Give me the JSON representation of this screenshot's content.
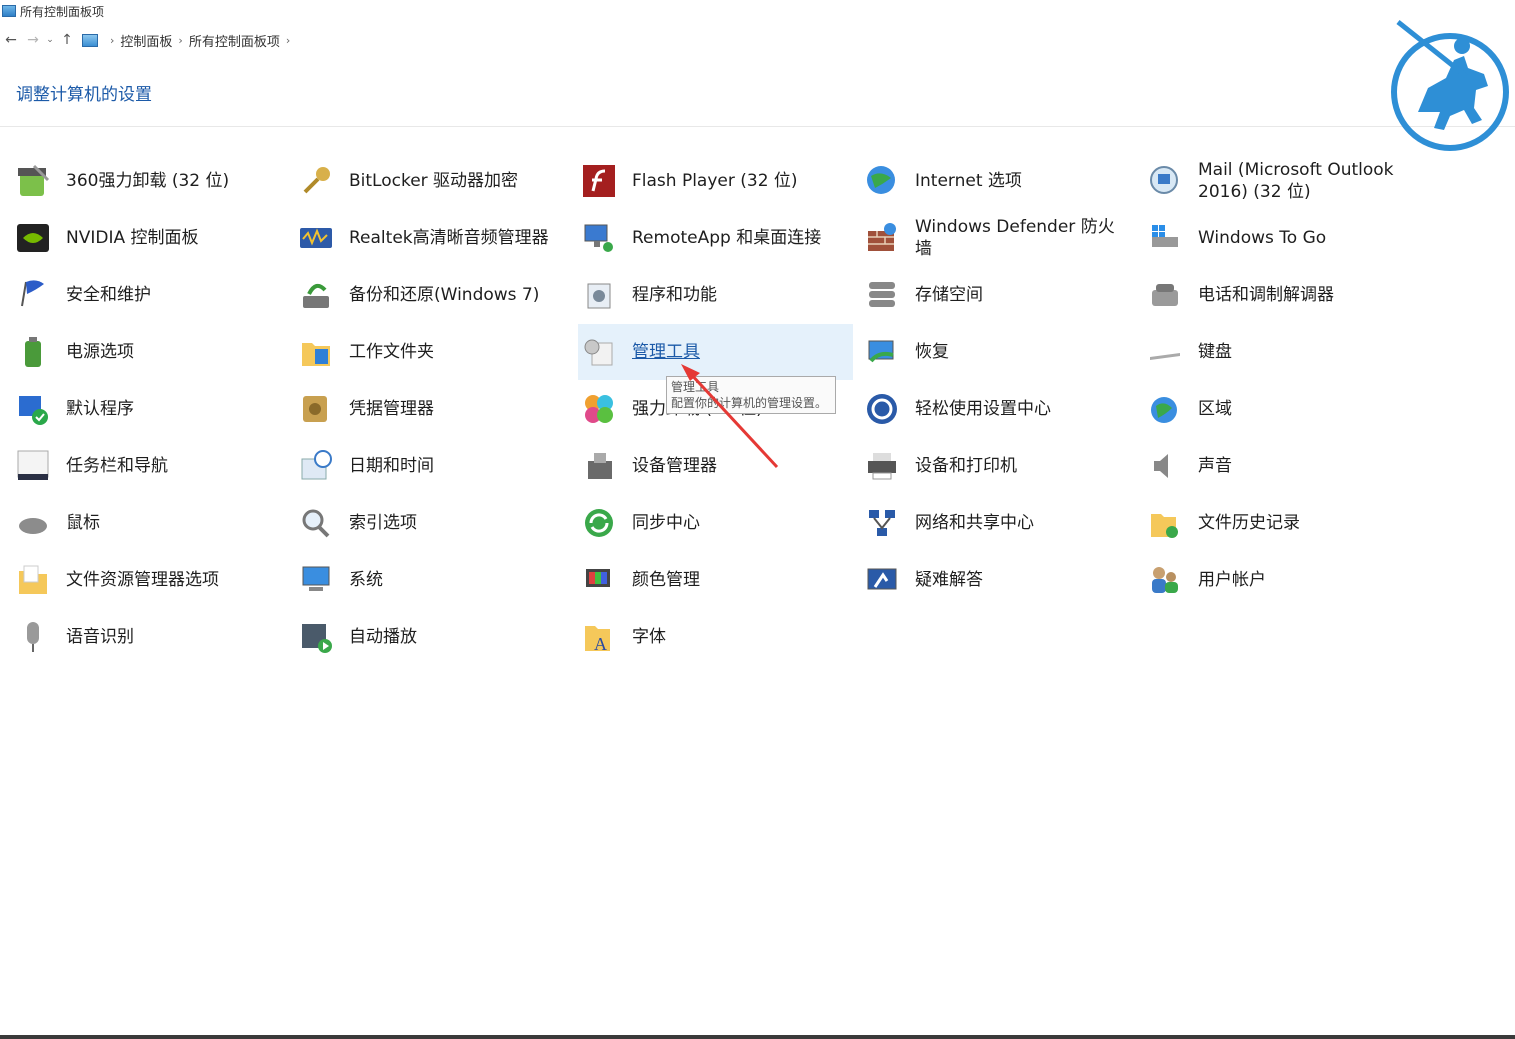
{
  "window": {
    "title": "所有控制面板项"
  },
  "nav": {
    "back": "←",
    "forward": "→",
    "recent": "⌄",
    "up": "↑",
    "breadcrumb": [
      "控制面板",
      "所有控制面板项"
    ]
  },
  "header": {
    "title": "调整计算机的设置"
  },
  "items": [
    [
      "360强力卸载 (32 位)",
      "NVIDIA 控制面板",
      "安全和维护",
      "电源选项",
      "默认程序",
      "任务栏和导航",
      "鼠标",
      "文件资源管理器选项",
      "语音识别"
    ],
    [
      "BitLocker 驱动器加密",
      "Realtek高清晰音频管理器",
      "备份和还原(Windows 7)",
      "工作文件夹",
      "凭据管理器",
      "日期和时间",
      "索引选项",
      "系统",
      "自动播放"
    ],
    [
      "Flash Player (32 位)",
      "RemoteApp 和桌面连接",
      "程序和功能",
      "管理工具",
      "强力卸载 (32 位)",
      "设备管理器",
      "同步中心",
      "颜色管理",
      "字体"
    ],
    [
      "Internet 选项",
      "Windows Defender 防火墙",
      "存储空间",
      "恢复",
      "轻松使用设置中心",
      "设备和打印机",
      "网络和共享中心",
      "疑难解答"
    ],
    [
      "Mail (Microsoft Outlook 2016) (32 位)",
      "Windows To Go",
      "电话和调制解调器",
      "键盘",
      "区域",
      "声音",
      "文件历史记录",
      "用户帐户"
    ]
  ],
  "hovered_item": "管理工具",
  "tooltip": {
    "title": "管理工具",
    "desc": "配置你的计算机的管理设置。"
  },
  "colors": {
    "link": "#1c5aa8",
    "hover_bg": "#e5f1fb",
    "arrow": "#e53935",
    "logo": "#2e8fd6"
  }
}
